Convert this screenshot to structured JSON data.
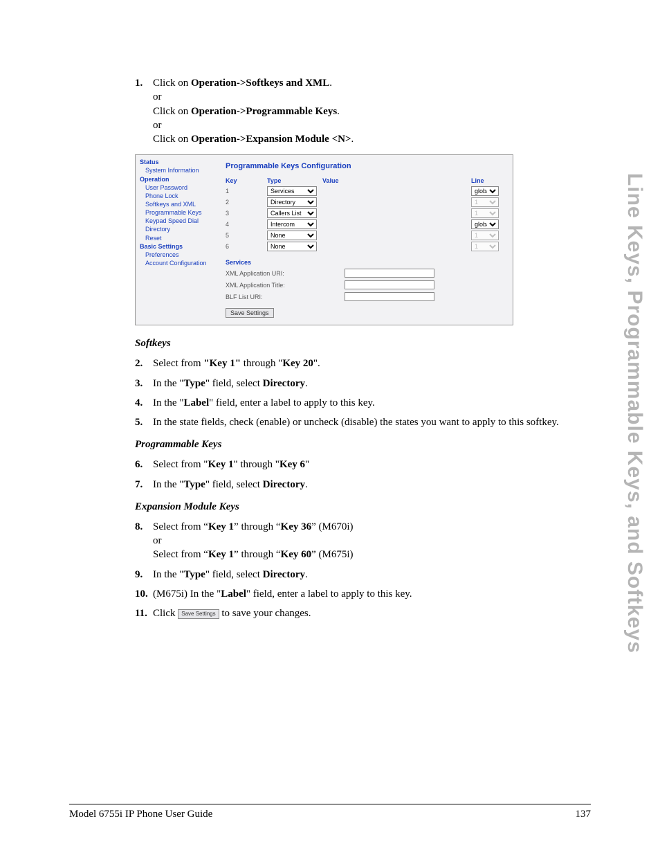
{
  "sideTab": "Line Keys, Programmable Keys, and Softkeys",
  "step1": {
    "num": "1.",
    "lineA_pre": "Click on ",
    "lineA_bold": "Operation->Softkeys and XML",
    "lineA_post": ".",
    "or1": "or",
    "lineB_pre": "Click on ",
    "lineB_bold": "Operation->Programmable Keys",
    "lineB_post": ".",
    "or2": "or",
    "lineC_pre": "Click on ",
    "lineC_bold": "Operation->Expansion Module <N>",
    "lineC_post": "."
  },
  "screenshot": {
    "nav": {
      "status": "Status",
      "sysInfo": "System Information",
      "operation": "Operation",
      "userPwd": "User Password",
      "phoneLock": "Phone Lock",
      "softkeys": "Softkeys and XML",
      "progKeys": "Programmable Keys",
      "keypad": "Keypad Speed Dial",
      "directory": "Directory",
      "reset": "Reset",
      "basic": "Basic Settings",
      "prefs": "Preferences",
      "acct": "Account Configuration"
    },
    "title": "Programmable Keys Configuration",
    "headers": {
      "key": "Key",
      "type": "Type",
      "value": "Value",
      "line": "Line"
    },
    "rows": [
      {
        "key": "1",
        "type": "Services",
        "line": "global",
        "lineDisabled": false
      },
      {
        "key": "2",
        "type": "Directory",
        "line": "1",
        "lineDisabled": true
      },
      {
        "key": "3",
        "type": "Callers List",
        "line": "1",
        "lineDisabled": true
      },
      {
        "key": "4",
        "type": "Intercom",
        "line": "global",
        "lineDisabled": false
      },
      {
        "key": "5",
        "type": "None",
        "line": "1",
        "lineDisabled": true
      },
      {
        "key": "6",
        "type": "None",
        "line": "1",
        "lineDisabled": true
      }
    ],
    "servicesHdr": "Services",
    "xmlUri": "XML Application URI:",
    "xmlTitle": "XML Application Title:",
    "blfUri": "BLF List URI:",
    "save": "Save Settings"
  },
  "softkeysHdr": "Softkeys",
  "step2": {
    "num": "2.",
    "pre": "Select from ",
    "b1": "\"Key 1\"",
    "mid": " through \"",
    "b2": "Key 20",
    "post": "\"."
  },
  "step3": {
    "num": "3.",
    "pre": "In the \"",
    "b1": "Type",
    "mid": "\" field, select ",
    "b2": "Directory",
    "post": "."
  },
  "step4": {
    "num": "4.",
    "pre": "In the \"",
    "b1": "Label",
    "post": "\" field, enter a label to apply to this key."
  },
  "step5": {
    "num": "5.",
    "text": "In the state fields, check (enable) or uncheck (disable) the states you want to apply to this softkey."
  },
  "progKeysHdr": "Programmable Keys",
  "step6": {
    "num": "6.",
    "pre": "Select from \"",
    "b1": "Key 1",
    "mid": "\" through \"",
    "b2": "Key 6",
    "post": "\""
  },
  "step7": {
    "num": "7.",
    "pre": "In the \"",
    "b1": "Type",
    "mid": "\" field, select ",
    "b2": "Directory",
    "post": "."
  },
  "expModHdr": "Expansion Module Keys",
  "step8": {
    "num": "8.",
    "lineA_pre": "Select from “",
    "lineA_b1": "Key 1",
    "lineA_mid": "” through “",
    "lineA_b2": "Key 36",
    "lineA_post": "” (M670i)",
    "or": "or",
    "lineB_pre": "Select from “",
    "lineB_b1": "Key 1",
    "lineB_mid": "” through “",
    "lineB_b2": "Key 60",
    "lineB_post": "” (M675i)"
  },
  "step9": {
    "num": "9.",
    "pre": "In the \"",
    "b1": "Type",
    "mid": "\" field, select ",
    "b2": "Directory",
    "post": "."
  },
  "step10": {
    "num": "10.",
    "pre": "(M675i) In the \"",
    "b1": "Label",
    "post": "\" field, enter a label to apply to this key."
  },
  "step11": {
    "num": "11.",
    "pre": "Click ",
    "btn": "Save Settings",
    "post": " to save your changes."
  },
  "footer": {
    "left": "Model 6755i IP Phone User Guide",
    "right": "137"
  }
}
